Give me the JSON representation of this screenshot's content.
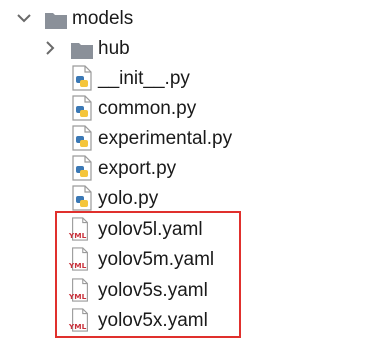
{
  "tree": {
    "root": {
      "label": "models",
      "icon": "folder-icon",
      "expanded": true
    },
    "items": [
      {
        "label": "hub",
        "icon": "folder-icon",
        "kind": "folder",
        "expanded": false
      },
      {
        "label": "__init__.py",
        "icon": "python-file-icon",
        "kind": "file"
      },
      {
        "label": "common.py",
        "icon": "python-file-icon",
        "kind": "file"
      },
      {
        "label": "experimental.py",
        "icon": "python-file-icon",
        "kind": "file"
      },
      {
        "label": "export.py",
        "icon": "python-file-icon",
        "kind": "file"
      },
      {
        "label": "yolo.py",
        "icon": "python-file-icon",
        "kind": "file"
      },
      {
        "label": "yolov5l.yaml",
        "icon": "yaml-file-icon",
        "kind": "file"
      },
      {
        "label": "yolov5m.yaml",
        "icon": "yaml-file-icon",
        "kind": "file"
      },
      {
        "label": "yolov5s.yaml",
        "icon": "yaml-file-icon",
        "kind": "file"
      },
      {
        "label": "yolov5x.yaml",
        "icon": "yaml-file-icon",
        "kind": "file"
      }
    ],
    "yaml_badge": "YML"
  },
  "colors": {
    "highlight_border": "#e0302d",
    "folder": "#8a9099",
    "python_blue": "#3a78b5",
    "python_yellow": "#f5c53b",
    "yaml_red": "#c9303a",
    "chevron": "#6a6a6a"
  }
}
